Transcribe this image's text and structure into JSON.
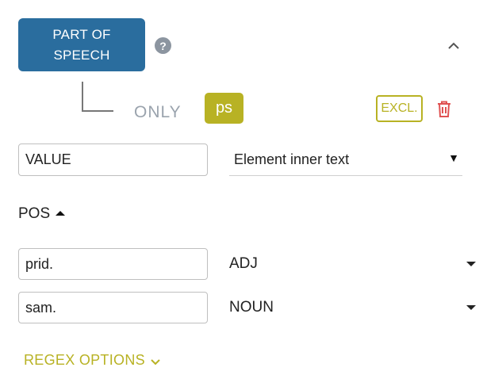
{
  "header": {
    "type_button_label": "PART OF\nSPEECH",
    "help_glyph": "?"
  },
  "condition": {
    "only_label": "ONLY",
    "tag_label": "ps",
    "exclude_label": "EXCL."
  },
  "value_row": {
    "field_value": "VALUE",
    "select_value": "Element inner text",
    "select_arrow": "▼"
  },
  "pos_section": {
    "title": "POS",
    "rows": [
      {
        "input_value": "prid.",
        "tag_value": "ADJ"
      },
      {
        "input_value": "sam.",
        "tag_value": "NOUN"
      }
    ]
  },
  "regex": {
    "label": "REGEX OPTIONS"
  },
  "colors": {
    "primary": "#2a6d9e",
    "accent": "#b8b224",
    "danger": "#e05252",
    "muted": "#9aa3ad"
  }
}
